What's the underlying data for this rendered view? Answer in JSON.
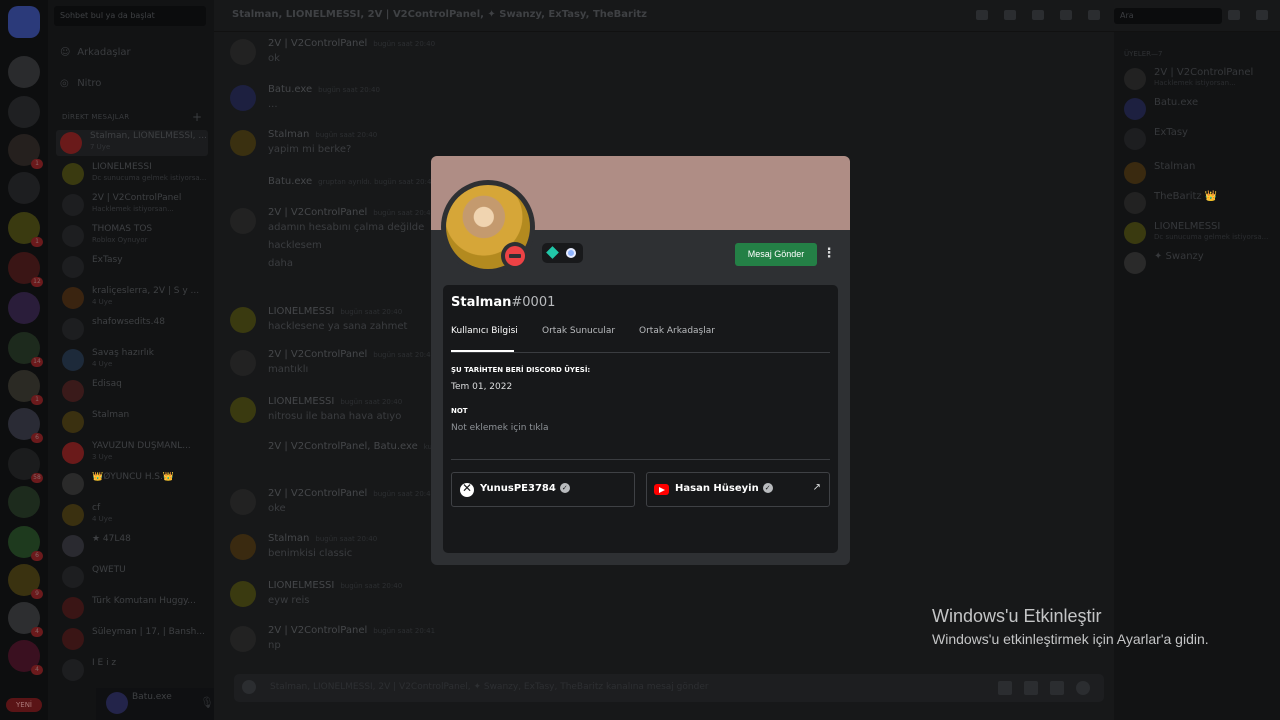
{
  "dm_sidebar": {
    "search_placeholder": "Sohbet bul ya da başlat",
    "friends": "Arkadaşlar",
    "nitro": "Nitro",
    "header": "DİREKT MESAJLAR",
    "items": [
      {
        "name": "Stalman, LIONELMESSI, ...",
        "sub": "7 Üye"
      },
      {
        "name": "LIONELMESSI",
        "sub": "Dc sunucuma gelmek istiyorsa..."
      },
      {
        "name": "2V | V2ControlPanel",
        "sub": "Hacklemek istiyorsan..."
      },
      {
        "name": "THOMAS TOS",
        "sub": "Roblox Oynuyor"
      },
      {
        "name": "ExTasy",
        "sub": ""
      },
      {
        "name": "kraliçeslerra, 2V | S y ...",
        "sub": "4 Üye"
      },
      {
        "name": "shafowsedits.48",
        "sub": ""
      },
      {
        "name": "Savaş hazırlık",
        "sub": "4 Üye"
      },
      {
        "name": "Edisaq",
        "sub": ""
      },
      {
        "name": "Stalman",
        "sub": ""
      },
      {
        "name": "YAVUZUN DÜŞMANL...",
        "sub": "3 Üye"
      },
      {
        "name": "👑ØYUNCU H.S.👑",
        "sub": ""
      },
      {
        "name": "cf",
        "sub": "4 Üye"
      },
      {
        "name": "★ 47L48",
        "sub": ""
      },
      {
        "name": "QWETU",
        "sub": ""
      },
      {
        "name": "Türk Komutanı Huggy...",
        "sub": ""
      },
      {
        "name": "Süleyman | 17, | Bansh...",
        "sub": ""
      },
      {
        "name": "İ E i z",
        "sub": ""
      }
    ],
    "user": {
      "name": "Batu.exe"
    }
  },
  "chat": {
    "title": "Stalman, LIONELMESSI, 2V | V2ControlPanel, ✦ Swanzy, ExTasy, TheBaritz",
    "search_placeholder": "Ara",
    "input_placeholder": "Stalman, LIONELMESSI, 2V | V2ControlPanel, ✦ Swanzy, ExTasy, TheBaritz kanalına mesaj gönder",
    "messages": [
      {
        "name": "2V | V2ControlPanel",
        "ts": "bugün saat 20:40",
        "text": "ok"
      },
      {
        "name": "Batu.exe",
        "ts": "bugün saat 20:40",
        "text": "..."
      },
      {
        "name": "Stalman",
        "ts": "bugün saat 20:40",
        "text": "yapim mi berke?"
      },
      {
        "name": "Batu.exe",
        "ts": "gruptan ayrıldı. bugün saat 20:40",
        "text": ""
      },
      {
        "name": "2V | V2ControlPanel",
        "ts": "bugün saat 20:40",
        "text": "adamın hesabını çalma değilde"
      },
      {
        "name": "",
        "ts": "",
        "text": "hacklesem"
      },
      {
        "name": "",
        "ts": "",
        "text": "daha"
      },
      {
        "name": "LIONELMESSI",
        "ts": "bugün saat 20:40",
        "text": "hacklesene ya sana zahmet"
      },
      {
        "name": "2V | V2ControlPanel",
        "ts": "bugün saat 20:40",
        "text": "mantıklı"
      },
      {
        "name": "LIONELMESSI",
        "ts": "bugün saat 20:40",
        "text": "nitrosu ile bana hava atıyo"
      },
      {
        "name": "2V | V2ControlPanel, Batu.exe",
        "ts": "kullanıcısını ekledi.",
        "text": ""
      },
      {
        "name": "2V | V2ControlPanel",
        "ts": "bugün saat 20:40",
        "text": "oke"
      },
      {
        "name": "Stalman",
        "ts": "bugün saat 20:40",
        "text": "benimkisi classic"
      },
      {
        "name": "LIONELMESSI",
        "ts": "bugün saat 20:40",
        "text": "eyw reis"
      },
      {
        "name": "2V | V2ControlPanel",
        "ts": "bugün saat 20:41",
        "text": "np"
      }
    ]
  },
  "members": {
    "header": "ÜYELER—7",
    "items": [
      {
        "name": "2V | V2ControlPanel",
        "sub": "Hacklemek istiyorsan..."
      },
      {
        "name": "Batu.exe",
        "sub": ""
      },
      {
        "name": "ExTasy",
        "sub": ""
      },
      {
        "name": "Stalman",
        "sub": ""
      },
      {
        "name": "TheBaritz 👑",
        "sub": ""
      },
      {
        "name": "LIONELMESSI",
        "sub": "Dc sunucuma gelmek istiyorsa..."
      },
      {
        "name": "✦ Swanzy",
        "sub": ""
      }
    ]
  },
  "profile": {
    "username": "Stalman",
    "discriminator": "#0001",
    "send_message": "Mesaj Gönder",
    "more": "⋮",
    "tabs": [
      "Kullanıcı Bilgisi",
      "Ortak Sunucular",
      "Ortak Arkadaşlar"
    ],
    "member_since_header": "ŞU TARİHTEN BERİ DISCORD ÜYESİ:",
    "member_since": "Tem 01, 2022",
    "note_header": "NOT",
    "note_placeholder": "Not eklemek için tıkla",
    "connections": [
      {
        "service": "xbox",
        "name": "YunusPE3784",
        "verified": "✓"
      },
      {
        "service": "youtube",
        "name": "Hasan Hüseyin",
        "verified": "✓",
        "external": "↗"
      }
    ],
    "colors": {
      "banner": "#af8d85",
      "button": "#248046",
      "dnd": "#ed4245"
    }
  },
  "watermark": {
    "title": "Windows'u Etkinleştir",
    "subtitle": "Windows'u etkinleştirmek için Ayarlar'a gidin."
  },
  "rail": {
    "new_label": "YENİ"
  }
}
